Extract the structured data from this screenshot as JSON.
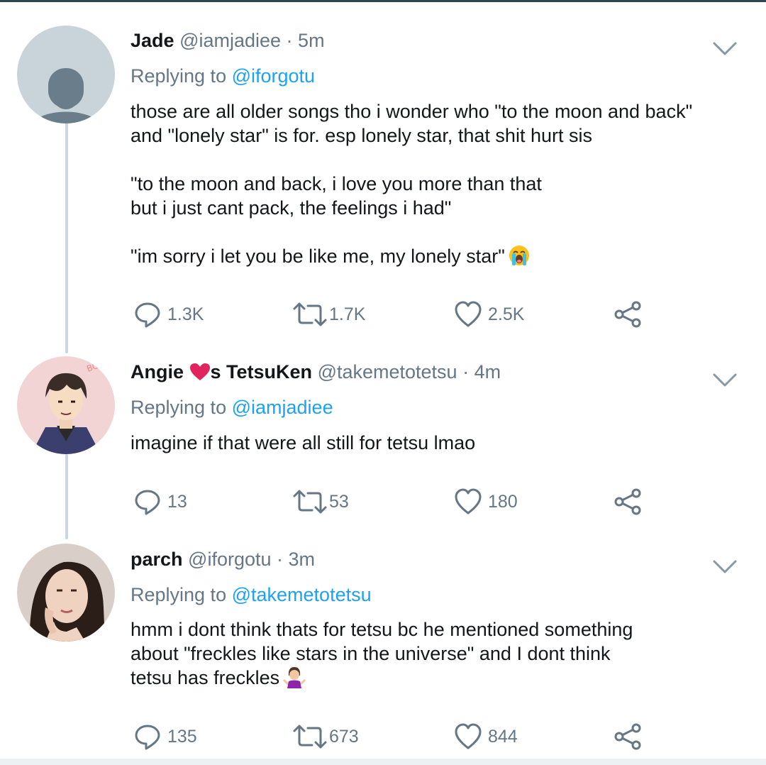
{
  "tweets": [
    {
      "name": "Jade",
      "handle": "@iamjadiee",
      "time": "5m",
      "replying_label": "Replying to",
      "replying_to": "@iforgotu",
      "lines": [
        "those are all older songs tho i wonder who \"to the moon and back\"",
        "and \"lonely star\" is for. esp lonely star, that shit hurt sis",
        "",
        "\"to the moon and back, i love you more than that",
        "but i just cant pack, the feelings i had\"",
        "",
        "\"im sorry i let you be like me, my lonely star\""
      ],
      "emoji": "loudly-crying-face",
      "replies": "1.3K",
      "retweets": "1.7K",
      "likes": "2.5K",
      "avatar": "default-profile-avatar"
    },
    {
      "name_part1": "Angie ",
      "name_heart": "❤️",
      "name_part2": "s TetsuKen",
      "handle": "@takemetotetsu",
      "time": "4m",
      "replying_label": "Replying to",
      "replying_to": "@iamjadiee",
      "lines": [
        "imagine if that were all still for tetsu lmao"
      ],
      "replies": "13",
      "retweets": "53",
      "likes": "180",
      "avatar": "anime-character-avatar"
    },
    {
      "name": "parch",
      "handle": "@iforgotu",
      "time": "3m",
      "replying_label": "Replying to",
      "replying_to": "@takemetotetsu",
      "lines": [
        "hmm i dont think thats for tetsu bc he mentioned something",
        "about \"freckles like stars in the universe\" and I dont think",
        "tetsu has freckles"
      ],
      "emoji": "person-shrugging",
      "replies": "135",
      "retweets": "673",
      "likes": "844",
      "avatar": "woman-portrait-avatar"
    }
  ],
  "separator": " · ",
  "colors": {
    "link": "#1da1f2",
    "secondary": "#657786",
    "text": "#14171a",
    "thread_line": "#ccd6dd",
    "heart": "#e0245e"
  }
}
